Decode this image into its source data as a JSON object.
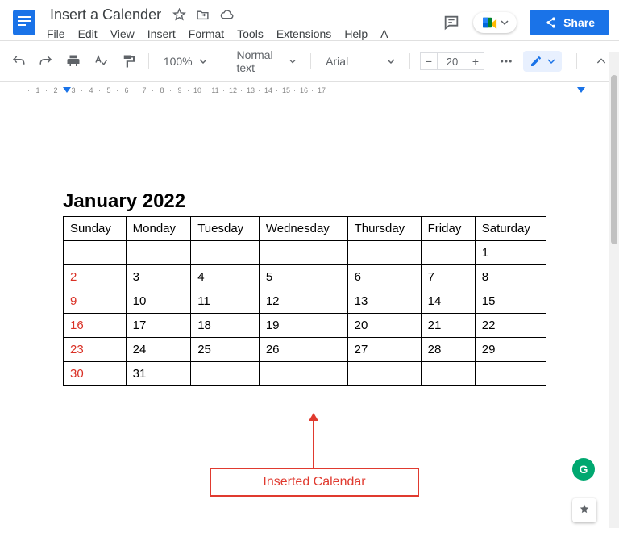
{
  "header": {
    "doc_title": "Insert a Calender",
    "star_icon": "star-icon",
    "move_icon": "move-icon",
    "cloud_icon": "cloud-icon",
    "share_label": "Share"
  },
  "menu": [
    "File",
    "Edit",
    "View",
    "Insert",
    "Format",
    "Tools",
    "Extensions",
    "Help",
    "A"
  ],
  "toolbar": {
    "zoom": "100%",
    "style": "Normal text",
    "font": "Arial",
    "font_size": "20"
  },
  "ruler_numbers": [
    "1",
    "2",
    "3",
    "4",
    "5",
    "6",
    "7",
    "8",
    "9",
    "10",
    "11",
    "12",
    "13",
    "14",
    "15",
    "16",
    "17"
  ],
  "calendar": {
    "title": "January 2022",
    "headers": [
      "Sunday",
      "Monday",
      "Tuesday",
      "Wednesday",
      "Thursday",
      "Friday",
      "Saturday"
    ],
    "rows": [
      [
        "",
        "",
        "",
        "",
        "",
        "",
        "1"
      ],
      [
        "2",
        "3",
        "4",
        "5",
        "6",
        "7",
        "8"
      ],
      [
        "9",
        "10",
        "11",
        "12",
        "13",
        "14",
        "15"
      ],
      [
        "16",
        "17",
        "18",
        "19",
        "20",
        "21",
        "22"
      ],
      [
        "23",
        "24",
        "25",
        "26",
        "27",
        "28",
        "29"
      ],
      [
        "30",
        "31",
        "",
        "",
        "",
        "",
        ""
      ]
    ]
  },
  "annotation_label": "Inserted Calendar"
}
